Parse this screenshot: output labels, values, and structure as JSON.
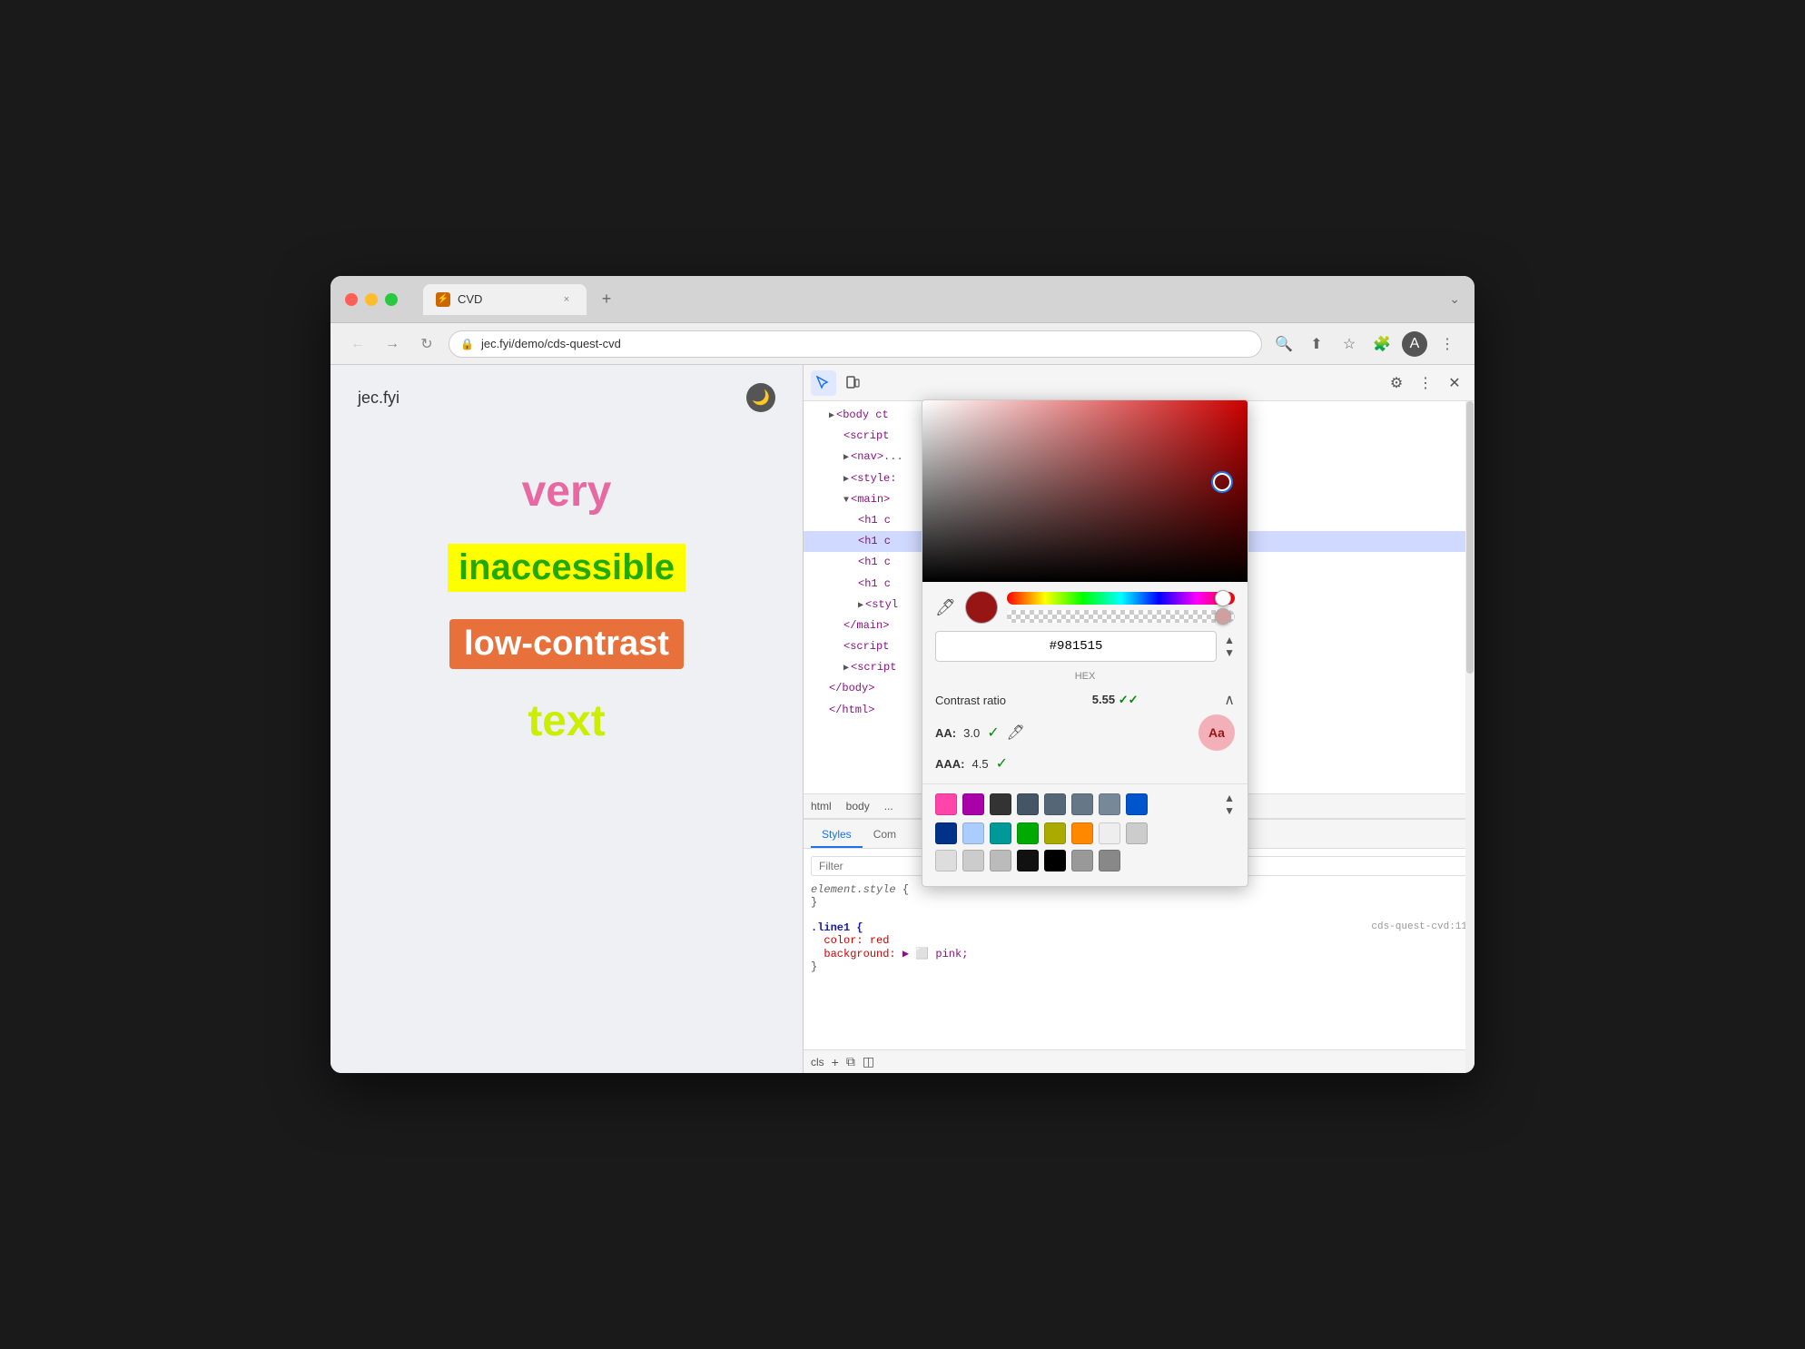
{
  "window": {
    "title": "CVD",
    "url": "jec.fyi/demo/cds-quest-cvd"
  },
  "tab": {
    "title": "CVD",
    "close_label": "×",
    "new_tab_label": "+"
  },
  "nav": {
    "back_label": "←",
    "forward_label": "→",
    "reload_label": "↻",
    "url": "jec.fyi/demo/cds-quest-cvd"
  },
  "webpage": {
    "site_title": "jec.fyi",
    "words": {
      "very": "very",
      "inaccessible": "inaccessible",
      "low_contrast": "low-contrast",
      "text": "text"
    }
  },
  "devtools": {
    "toolbar": {
      "inspect_label": "🔲",
      "device_label": "📱",
      "settings_label": "⚙",
      "more_label": "⋮",
      "close_label": "✕"
    },
    "dom": {
      "lines": [
        {
          "indent": 1,
          "content": "▶ <body ct"
        },
        {
          "indent": 2,
          "content": "<script"
        },
        {
          "indent": 2,
          "content": "▶ <nav>..."
        },
        {
          "indent": 2,
          "content": "▶ <style:"
        },
        {
          "indent": 2,
          "content": "▼ <main>"
        },
        {
          "indent": 3,
          "content": "<h1 c"
        },
        {
          "indent": 3,
          "content": "<h1 c"
        },
        {
          "indent": 3,
          "content": "<h1 c"
        },
        {
          "indent": 3,
          "content": "<h1 c"
        },
        {
          "indent": 3,
          "content": "▶ <styl"
        },
        {
          "indent": 2,
          "content": "</main>"
        },
        {
          "indent": 2,
          "content": "<script"
        },
        {
          "indent": 2,
          "content": "▶ <script"
        },
        {
          "indent": 1,
          "content": "</body>"
        },
        {
          "indent": 1,
          "content": "</html>"
        }
      ]
    },
    "tabs": [
      "html",
      "body"
    ],
    "panel_tabs": [
      "Styles",
      "Com"
    ],
    "filter_placeholder": "Filter",
    "css": {
      "element_styles": "element.style",
      "brace_open": "{",
      "brace_close": "}",
      "rule1_selector": ".line1 {",
      "rule1_color_prop": "color:",
      "rule1_color_value": "red",
      "rule1_bg_prop": "background:",
      "rule1_bg_value": "▶ ⬜ pink;",
      "rule1_brace_close": "}"
    },
    "bottom_toolbar": {
      "filter_label": "cls",
      "plus_label": "+",
      "copy_label": "⧉",
      "toggle_label": "◫"
    },
    "code_ref": "cds-quest-cvd:11"
  },
  "color_picker": {
    "hex_value": "#981515",
    "hex_label": "HEX",
    "contrast_ratio_label": "Contrast ratio",
    "contrast_ratio_value": "5.55",
    "aa_label": "AA:",
    "aa_value": "3.0",
    "aaa_label": "AAA:",
    "aaa_value": "4.5",
    "preview_text": "Aa",
    "swatches_row1": [
      "#ff00ff",
      "#aa00aa",
      "#333333",
      "#445566",
      "#556677",
      "#667788",
      "#778899",
      "#0055cc"
    ],
    "swatches_row2": [
      "#003388",
      "#aaccff",
      "#009999",
      "#00aa00",
      "#aaaa00",
      "#ff8800",
      "#eeeeee",
      "#cccccc"
    ],
    "swatches_row3": [
      "#dddddd",
      "#cccccc",
      "#bbbbbb",
      "#111111",
      "#000000",
      "#999999",
      "#888888"
    ]
  }
}
